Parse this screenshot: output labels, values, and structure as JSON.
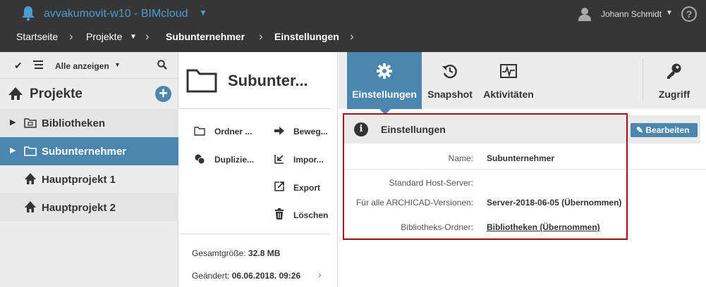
{
  "header": {
    "app_title": "avvakumovit-w10 - BIMcloud",
    "user_name": "Johann Schmidt",
    "help": "?"
  },
  "breadcrumb": {
    "items": [
      "Startseite",
      "Projekte",
      "Subunternehmer",
      "Einstellungen"
    ]
  },
  "sidebar": {
    "show_all": "Alle anzeigen",
    "header": "Projekte",
    "add": "+",
    "items": [
      {
        "label": "Bibliotheken"
      },
      {
        "label": "Subunternehmer"
      },
      {
        "label": "Hauptprojekt 1"
      },
      {
        "label": "Hauptprojekt 2"
      }
    ]
  },
  "middle": {
    "title": "Subunter...",
    "actions": {
      "new_folder": "Ordner ...",
      "move": "Beweg...",
      "duplicate": "Duplizie...",
      "import": "Impor...",
      "export": "Export",
      "delete": "Löschen"
    },
    "size_label": "Gesamtgröße:",
    "size_value": "32.8 MB",
    "changed_label": "Geändert:",
    "changed_value": "06.06.2018. 09:26"
  },
  "tabs": {
    "settings": "Einstellungen",
    "snapshot": "Snapshot",
    "activities": "Aktivitäten",
    "access": "Zugriff"
  },
  "settings_panel": {
    "title": "Einstellungen",
    "edit_button": "Bearbeiten",
    "rows": [
      {
        "label": "Name:",
        "value": "Subunternehmer"
      },
      {
        "label": "Standard Host-Server:",
        "value": ""
      },
      {
        "label": "Für alle ARCHICAD-Versionen:",
        "value": "Server-2018-06-05 (Übernommen)"
      },
      {
        "label": "Bibliotheks-Ordner:",
        "value": "Bibliotheken (Übernommen)"
      }
    ]
  },
  "colors": {
    "accent": "#4a86ae",
    "topbar": "#363636",
    "highlight_border": "#a30e15",
    "app_title": "#4e9bd1"
  }
}
